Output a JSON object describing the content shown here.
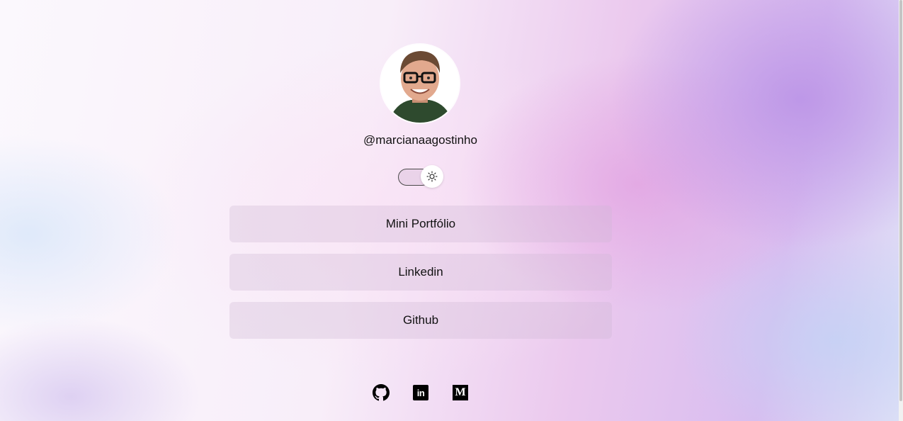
{
  "profile": {
    "username": "@marcianaagostinho",
    "avatar_alt": "profile-photo"
  },
  "theme_toggle": {
    "state": "light",
    "icon": "sun-icon"
  },
  "links": [
    {
      "label": "Mini Portfólio"
    },
    {
      "label": "Linkedin"
    },
    {
      "label": "Github"
    }
  ],
  "social": {
    "github_icon": "github-icon",
    "linkedin_icon": "linkedin-icon",
    "linkedin_text": "in",
    "medium_icon": "medium-icon",
    "medium_text": "M"
  },
  "colors": {
    "text": "#111111",
    "button_bg": "#d9c5d9",
    "gradient_purple": "#c9a3ea",
    "gradient_pink": "#eec6ee"
  }
}
